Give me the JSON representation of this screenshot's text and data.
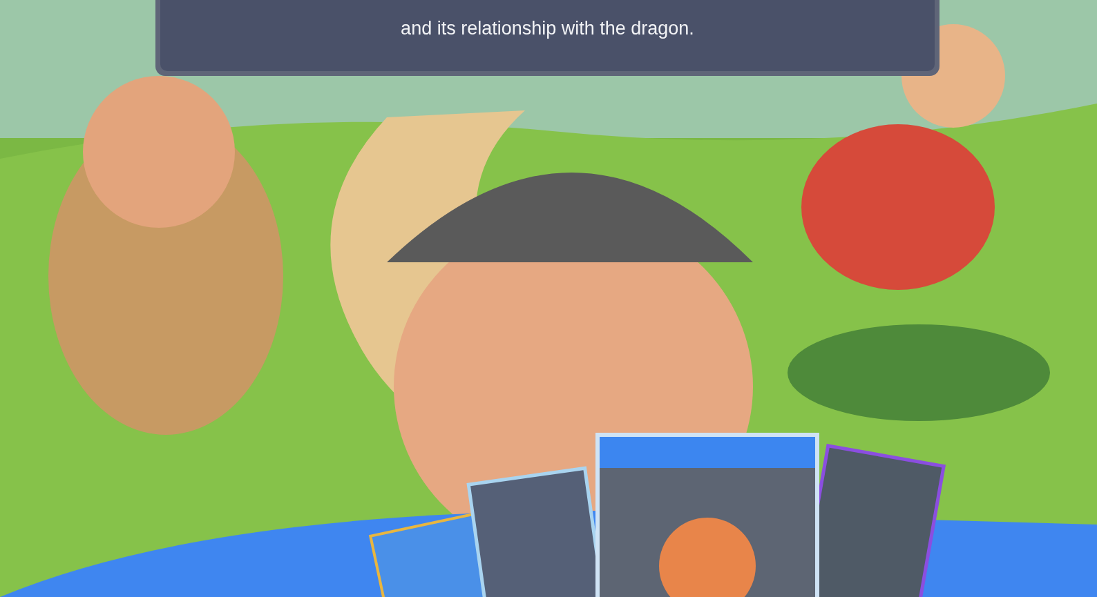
{
  "story_panel": {
    "lines": [
      "and its relationship with the dragon."
    ]
  }
}
